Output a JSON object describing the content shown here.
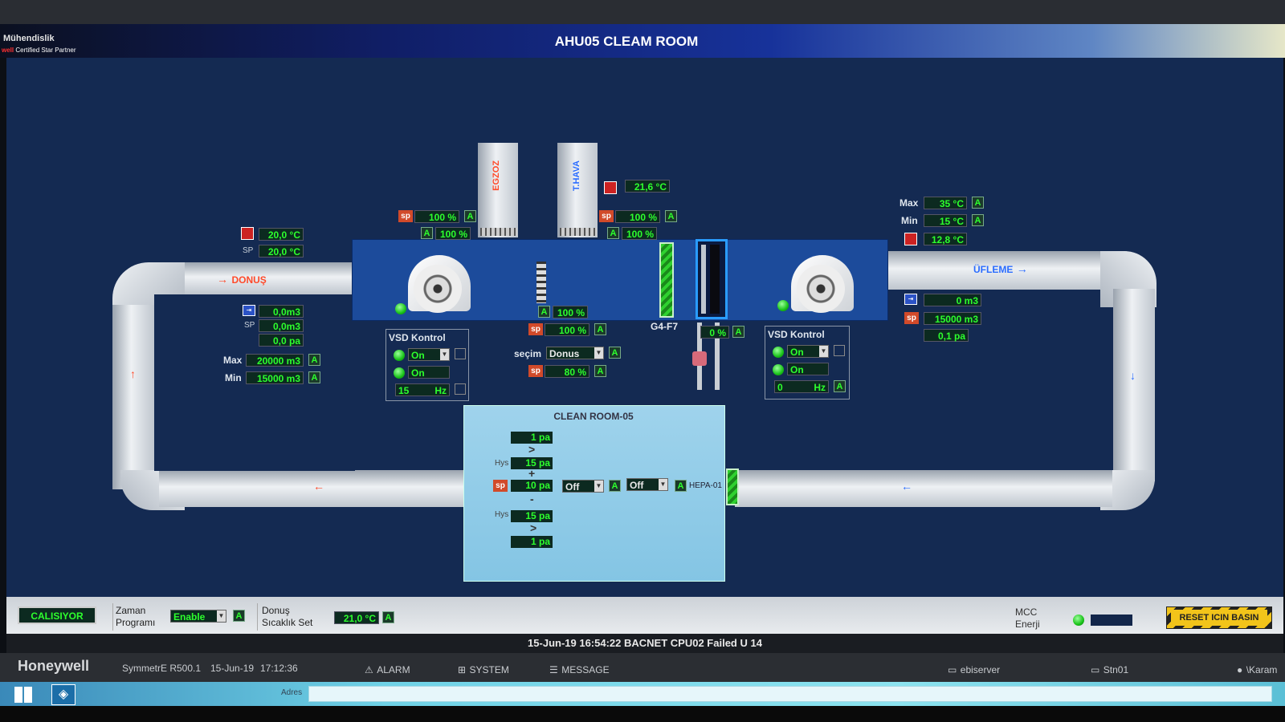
{
  "header": {
    "title": "AHU05 CLEAM ROOM",
    "brand_line1": "Mühendislik",
    "brand_line2_red": "well",
    "brand_line2": "Certified Star Partner"
  },
  "ducts": {
    "egzoz_label": "EGZOZ",
    "thava_label": "T.HAVA",
    "donus_label": "DONUŞ",
    "ufleme_label": "ÜFLEME",
    "filter_label": "G4-F7",
    "hepa_label": "HEPA-01"
  },
  "return_side": {
    "temp": "20,0 °C",
    "sp_label": "SP",
    "temp_sp": "20,0 °C",
    "flow": "0,0m3",
    "flow_sp_label": "SP",
    "flow_sp": "0,0m3",
    "pressure": "0,0 pa",
    "max_label": "Max",
    "max_value": "20000 m3",
    "min_label": "Min",
    "min_value": "15000 m3"
  },
  "exhaust_damper": {
    "sp_label": "sp",
    "sp_value": "100 %",
    "value": "100 %"
  },
  "fresh_air": {
    "temp": "21,6 °C",
    "sp_label": "sp",
    "sp_value": "100 %",
    "value": "100 %"
  },
  "mix_damper": {
    "value": "100 %",
    "sp_label": "sp",
    "sp_value": "100 %",
    "secim_label": "seçim",
    "secim_value": "Donus",
    "sp2_label": "sp",
    "sp2_value": "80 %"
  },
  "valve": {
    "value": "0 %"
  },
  "supply_side": {
    "max_label": "Max",
    "max_value": "35 °C",
    "min_label": "Min",
    "min_value": "15 °C",
    "temp": "12,8 °C",
    "flow": "0 m3",
    "sp_label": "sp",
    "flow_sp": "15000 m3",
    "pressure": "0,1 pa"
  },
  "vsd_return": {
    "title": "VSD Kontrol",
    "cmd": "On",
    "status": "On",
    "freq": "15",
    "freq_unit": "Hz"
  },
  "vsd_supply": {
    "title": "VSD Kontrol",
    "cmd": "On",
    "status": "On",
    "freq": "0",
    "freq_unit": "Hz"
  },
  "clean_room": {
    "title": "CLEAN ROOM-05",
    "upper_limit": "1 pa",
    "gt1": ">",
    "hys1_label": "Hys",
    "hys1": "15 pa",
    "plus": "+",
    "sp_label": "sp",
    "sp_value": "10 pa",
    "mode1": "Off",
    "mode2": "Off",
    "minus": "-",
    "hys2_label": "Hys",
    "hys2": "15 pa",
    "gt2": ">",
    "lower_limit": "1 pa"
  },
  "bottom": {
    "running": "CALISIYOR",
    "schedule_label1": "Zaman",
    "schedule_label2": "Programı",
    "schedule_value": "Enable",
    "return_set_label1": "Donuş",
    "return_set_label2": "Sıcaklık Set",
    "return_set_value": "21,0 °C",
    "mcc_label1": "MCC",
    "mcc_label2": "Enerji",
    "reset_label": "RESET ICIN BASIN"
  },
  "status_line": "15-Jun-19  16:54:22  BACNET  CPU02  Failed  U 14",
  "footer": {
    "brand": "Honeywell",
    "product": "SymmetrE R500.1",
    "date": "15-Jun-19",
    "time": "17:12:36",
    "alarm": "ALARM",
    "system": "SYSTEM",
    "message": "MESSAGE",
    "server": "ebiserver",
    "station": "Stn01",
    "user": "\\Karam"
  },
  "taskbar": {
    "address_label": "Adres"
  },
  "a_label": "A"
}
